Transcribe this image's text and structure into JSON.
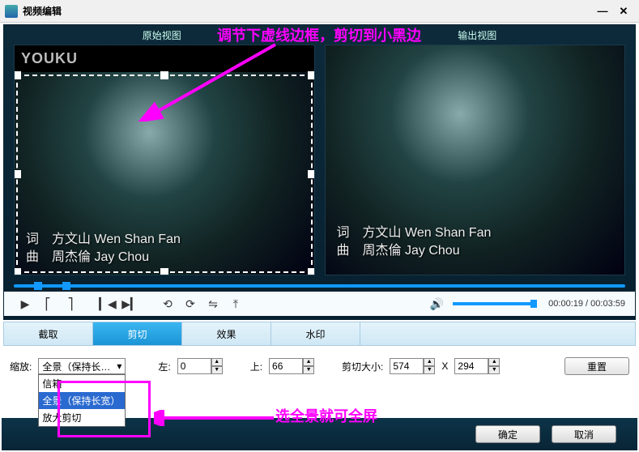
{
  "title": "视频编辑",
  "annotations": {
    "top": "调节下虚线边框，剪切到小黑边",
    "bottom": "选全景就可全屏"
  },
  "preview": {
    "original_label": "原始视图",
    "output_label": "输出视图",
    "watermark": "YOUKU",
    "credit_line1_label": "词",
    "credit_line1_name": "方文山",
    "credit_line1_roman": "Wen Shan Fan",
    "credit_line2_label": "曲",
    "credit_line2_name": "周杰倫",
    "credit_line2_roman": "Jay Chou"
  },
  "playback": {
    "time_current": "00:00:19",
    "time_total": "00:03:59",
    "time_sep": " / "
  },
  "tabs": {
    "capture": "截取",
    "crop": "剪切",
    "effects": "效果",
    "watermark": "水印",
    "active": "crop"
  },
  "crop": {
    "zoom_label": "缩放:",
    "zoom_selected": "全景（保持长…",
    "zoom_options": [
      "信箱",
      "全景（保持长宽）",
      "放大剪切"
    ],
    "zoom_selected_index": 1,
    "left_label": "左:",
    "left_value": "0",
    "top_label": "上:",
    "top_value": "66",
    "size_label": "剪切大小:",
    "width_value": "574",
    "size_x": "X",
    "height_value": "294",
    "reset_label": "重置"
  },
  "buttons": {
    "ok": "确定",
    "cancel": "取消"
  }
}
